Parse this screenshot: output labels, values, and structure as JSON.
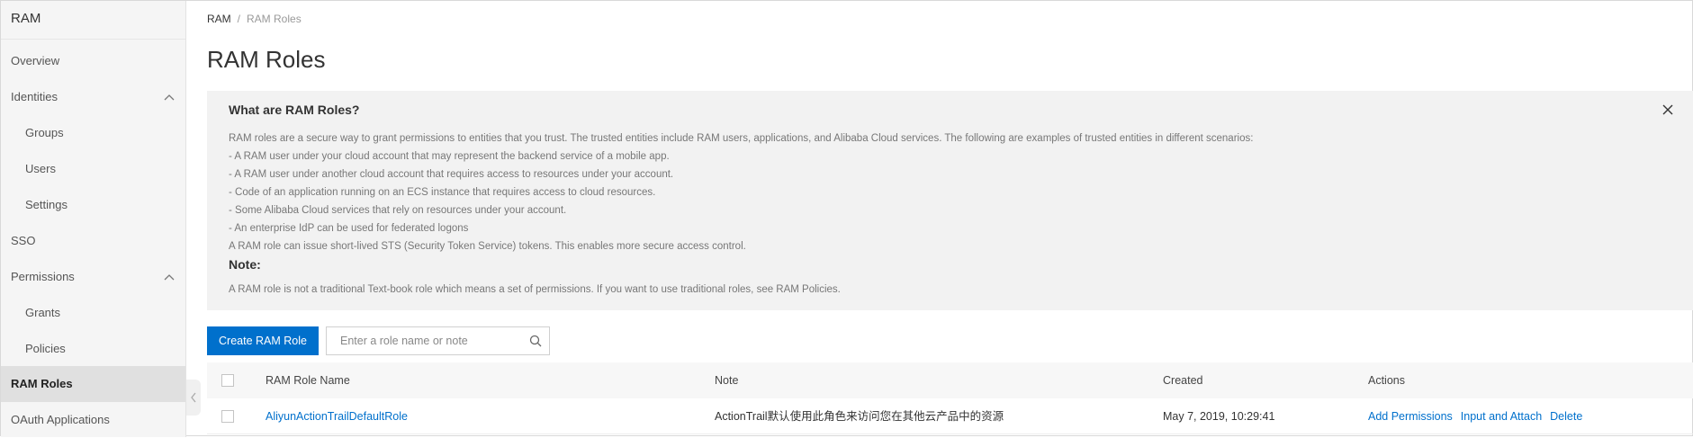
{
  "sidebar": {
    "title": "RAM",
    "items": [
      {
        "label": "Overview"
      },
      {
        "label": "Identities"
      },
      {
        "label": "Groups"
      },
      {
        "label": "Users"
      },
      {
        "label": "Settings"
      },
      {
        "label": "SSO"
      },
      {
        "label": "Permissions"
      },
      {
        "label": "Grants"
      },
      {
        "label": "Policies"
      },
      {
        "label": "RAM Roles"
      },
      {
        "label": "OAuth Applications"
      }
    ]
  },
  "breadcrumb": {
    "root": "RAM",
    "separator": "/",
    "current": "RAM Roles"
  },
  "page_title": "RAM Roles",
  "info": {
    "title": "What are RAM Roles?",
    "lines": [
      "RAM roles are a secure way to grant permissions to entities that you trust. The trusted entities include RAM users, applications, and Alibaba Cloud services. The following are examples of trusted entities in different scenarios:",
      "- A RAM user under your cloud account that may represent the backend service of a mobile app.",
      "- A RAM user under another cloud account that requires access to resources under your account.",
      "- Code of an application running on an ECS instance that requires access to cloud resources.",
      "- Some Alibaba Cloud services that rely on resources under your account.",
      "- An enterprise IdP can be used for federated logons",
      "A RAM role can issue short-lived STS (Security Token Service) tokens. This enables more secure access control."
    ],
    "note_title": "Note:",
    "note_text": "A RAM role is not a traditional Text-book role which means a set of permissions. If you want to use traditional roles, see RAM Policies."
  },
  "toolbar": {
    "create_label": "Create RAM Role",
    "search_placeholder": "Enter a role name or note"
  },
  "table": {
    "columns": [
      "RAM Role Name",
      "Note",
      "Created",
      "Actions"
    ],
    "rows": [
      {
        "name": "AliyunActionTrailDefaultRole",
        "note": "ActionTrail默认使用此角色来访问您在其他云产品中的资源",
        "created": "May 7, 2019, 10:29:41",
        "actions": [
          "Add Permissions",
          "Input and Attach",
          "Delete"
        ]
      }
    ]
  },
  "colors": {
    "primary": "#0070cc",
    "sidebar_bg": "#f5f5f5",
    "sidebar_active": "#e0e0e0",
    "info_bg": "#f2f2f2"
  }
}
